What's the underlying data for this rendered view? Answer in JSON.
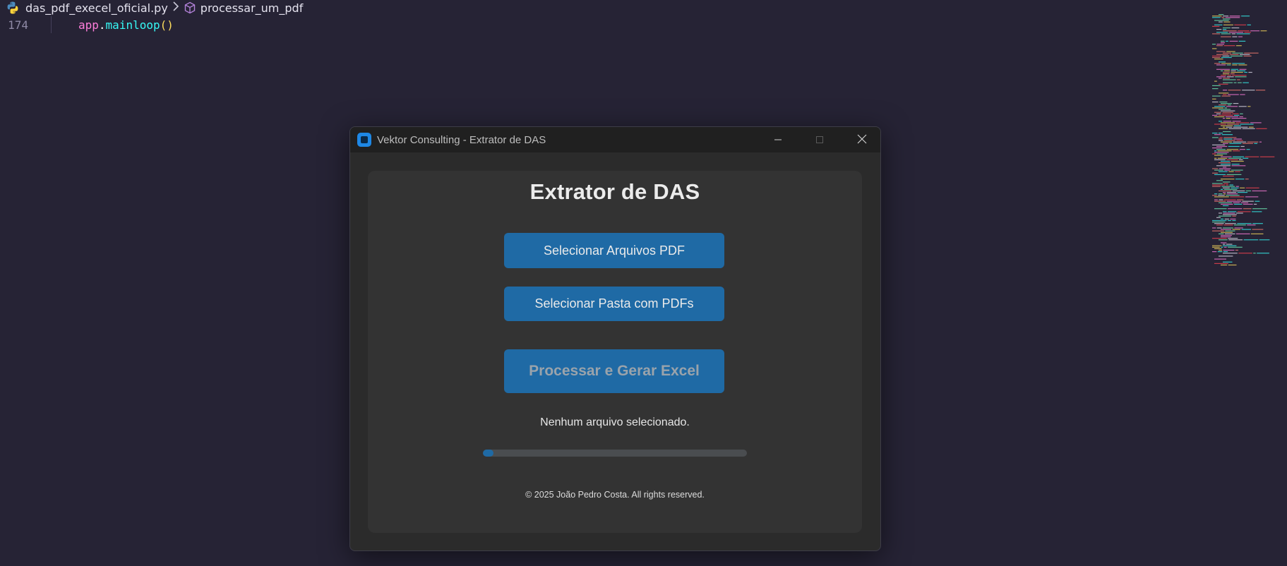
{
  "editor": {
    "breadcrumb": {
      "file": "das_pdf_execel_oficial.py",
      "symbol": "processar_um_pdf"
    },
    "code": {
      "line_number": "174",
      "object": "app",
      "dot": ".",
      "method": "mainloop",
      "parens": "()"
    }
  },
  "window": {
    "title": "Vektor Consulting - Extrator de DAS"
  },
  "app": {
    "heading": "Extrator de DAS",
    "select_files_label": "Selecionar Arquivos PDF",
    "select_folder_label": "Selecionar Pasta com PDFs",
    "process_label": "Processar e Gerar Excel",
    "status": "Nenhum arquivo selecionado.",
    "progress": 0.04,
    "footer": "© 2025 João Pedro Costa. All rights reserved."
  },
  "colors": {
    "editor_bg": "#262335",
    "accent": "#1f6aa5",
    "window_bg": "#2b2b2b",
    "content_bg": "#333333"
  },
  "icons": {
    "file": "python-icon",
    "separator": "chevron-right-icon",
    "symbol": "cube-icon",
    "app": "app-icon",
    "minimize": "minimize-icon",
    "maximize": "maximize-icon",
    "close": "close-icon"
  }
}
